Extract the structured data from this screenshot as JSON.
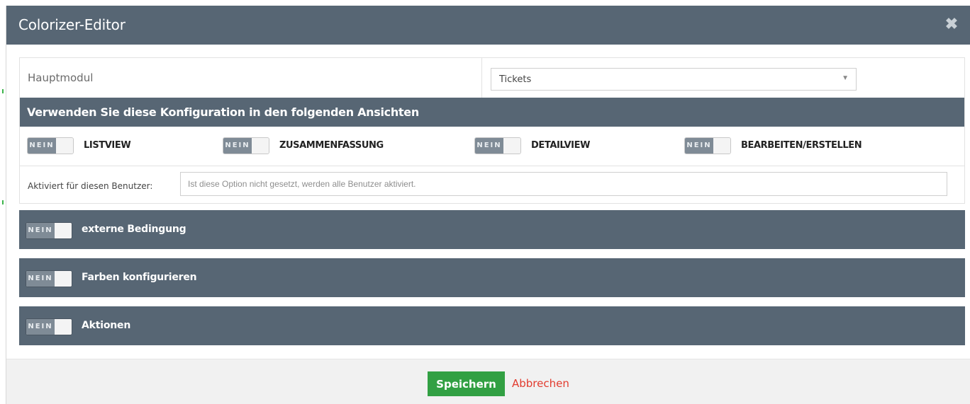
{
  "window": {
    "title": "Colorizer-Editor",
    "close_icon": "close-icon"
  },
  "main_module": {
    "label": "Hauptmodul",
    "selected": "Tickets"
  },
  "views_section": {
    "title": "Verwenden Sie diese Konfiguration in den folgenden Ansichten"
  },
  "views": [
    {
      "state": "NEIN",
      "label": "LISTVIEW"
    },
    {
      "state": "NEIN",
      "label": "ZUSAMMENFASSUNG"
    },
    {
      "state": "NEIN",
      "label": "DETAILVIEW"
    },
    {
      "state": "NEIN",
      "label": "BEARBEITEN/ERSTELLEN"
    }
  ],
  "users": {
    "label": "Aktiviert für diesen Benutzer:",
    "placeholder": "Ist diese Option nicht gesetzt, werden alle Benutzer aktiviert.",
    "value": ""
  },
  "blocks": [
    {
      "state": "NEIN",
      "label": "externe Bedingung"
    },
    {
      "state": "NEIN",
      "label": "Farben konfigurieren"
    },
    {
      "state": "NEIN",
      "label": "Aktionen"
    }
  ],
  "footer": {
    "save_label": "Speichern",
    "cancel_label": "Abbrechen"
  },
  "colors": {
    "header": "#576674",
    "save": "#32a043",
    "cancel": "#e23b2e",
    "toggle_off": "#7f8b96"
  }
}
